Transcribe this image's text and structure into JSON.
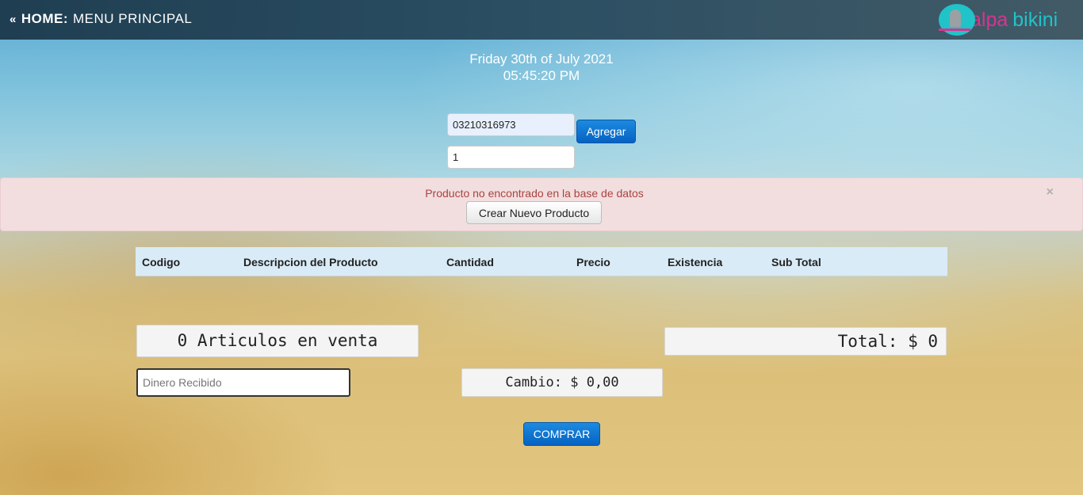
{
  "header": {
    "back_glyph": "«",
    "home_label": "HOME:",
    "menu_label": "MENU PRINCIPAL"
  },
  "logo": {
    "word1": "alpa",
    "word2": "bikini"
  },
  "clock": {
    "date": "Friday 30th of July 2021",
    "time": "05:45:20 PM"
  },
  "entry": {
    "code_value": "03210316973",
    "quantity_value": "1",
    "add_label": "Agregar"
  },
  "alert": {
    "message": "Producto no encontrado en la base de datos",
    "close_glyph": "×",
    "create_label": "Crear Nuevo Producto"
  },
  "table": {
    "columns": [
      "Codigo",
      "Descripcion del Producto",
      "Cantidad",
      "Precio",
      "Existencia",
      "Sub Total"
    ],
    "rows": []
  },
  "summary": {
    "items_text": "0 Articulos en venta",
    "total_text": "Total: $ 0",
    "cambio_text": "Cambio: $ 0,00",
    "dinero_placeholder": "Dinero Recibido",
    "dinero_value": ""
  },
  "actions": {
    "buy_label": "COMPRAR"
  },
  "colors": {
    "primary": "#0662c2",
    "alert_bg": "#f2dede",
    "alert_text": "#a94442",
    "header_bg": "#1f3e52",
    "logo_pink": "#d9338f",
    "logo_teal": "#20c3c8"
  }
}
